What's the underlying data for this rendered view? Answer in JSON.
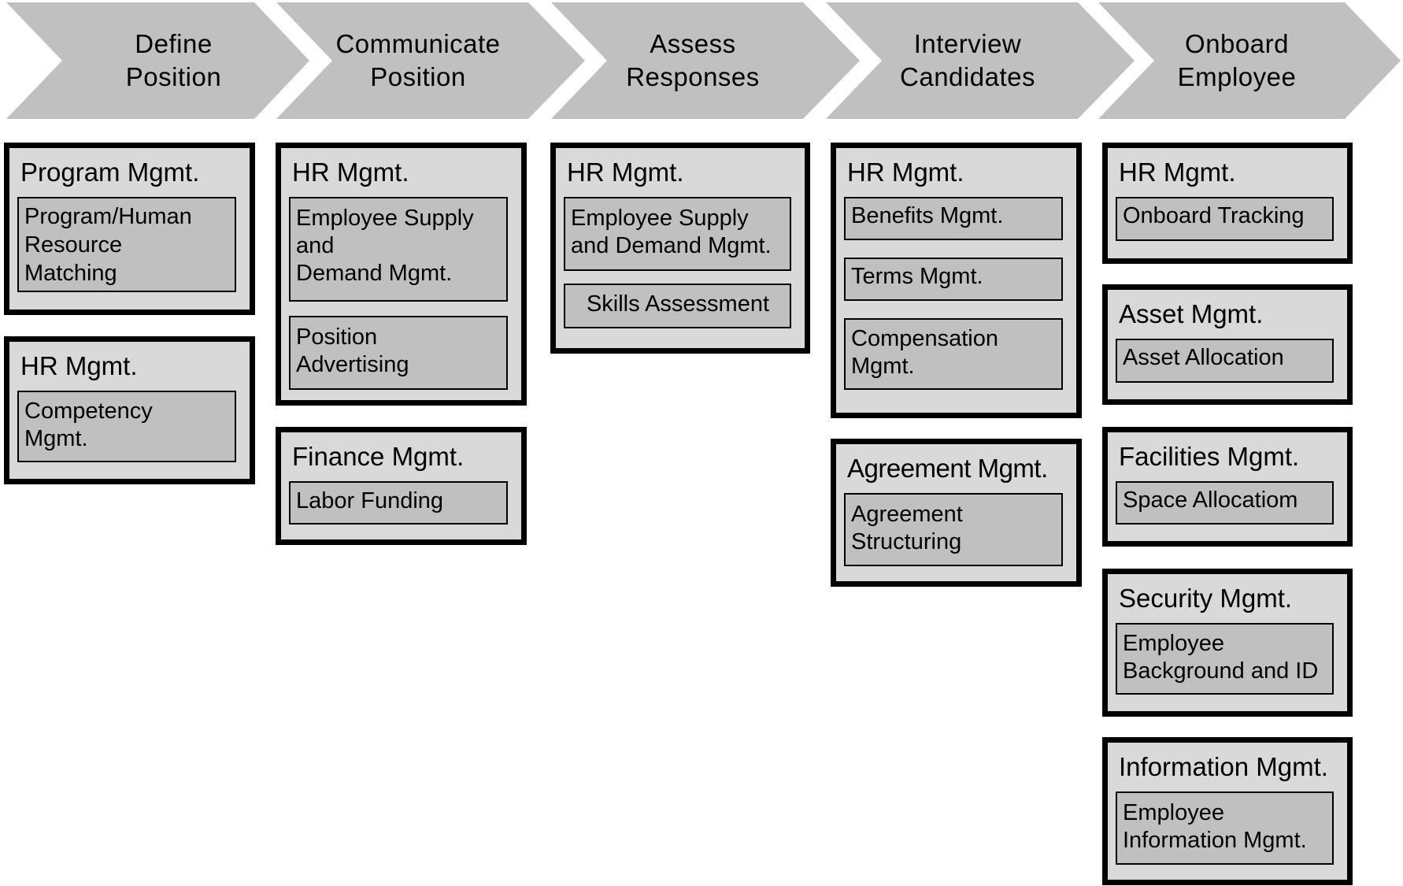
{
  "process_steps": [
    {
      "label": "Define\nPosition"
    },
    {
      "label": "Communicate\nPosition"
    },
    {
      "label": "Assess\nResponses"
    },
    {
      "label": "Interview\nCandidates"
    },
    {
      "label": "Onboard\nEmployee"
    }
  ],
  "columns": [
    {
      "groups": [
        {
          "title": "Program Mgmt.",
          "items": [
            "Program/Human\nResource\nMatching"
          ]
        },
        {
          "title": "HR Mgmt.",
          "items": [
            "Competency\nMgmt."
          ]
        }
      ]
    },
    {
      "groups": [
        {
          "title": "HR Mgmt.",
          "items": [
            "Employee Supply\nand\nDemand Mgmt.",
            "Position\nAdvertising"
          ]
        },
        {
          "title": "Finance Mgmt.",
          "items": [
            "Labor Funding"
          ]
        }
      ]
    },
    {
      "groups": [
        {
          "title": "HR Mgmt.",
          "items": [
            "Employee Supply\nand Demand  Mgmt.",
            "Skills Assessment"
          ]
        }
      ]
    },
    {
      "groups": [
        {
          "title": "HR Mgmt.",
          "items": [
            "Benefits Mgmt.",
            "Terms Mgmt.",
            "Compensation\nMgmt."
          ]
        },
        {
          "title": "Agreement Mgmt.",
          "items": [
            "Agreement\nStructuring"
          ]
        }
      ]
    },
    {
      "groups": [
        {
          "title": "HR Mgmt.",
          "items": [
            "Onboard Tracking"
          ]
        },
        {
          "title": "Asset Mgmt.",
          "items": [
            "Asset Allocation"
          ]
        },
        {
          "title": "Facilities Mgmt.",
          "items": [
            "Space Allocatiom"
          ]
        },
        {
          "title": "Security Mgmt.",
          "items": [
            "Employee\nBackground and ID"
          ]
        },
        {
          "title": "Information Mgmt.",
          "items": [
            "Employee\nInformation Mgmt."
          ]
        }
      ]
    }
  ],
  "colors": {
    "chevron_fill": "#c0c0c0",
    "group_fill": "#d9d9d9",
    "item_fill": "#c0c0c0",
    "border": "#000000"
  }
}
